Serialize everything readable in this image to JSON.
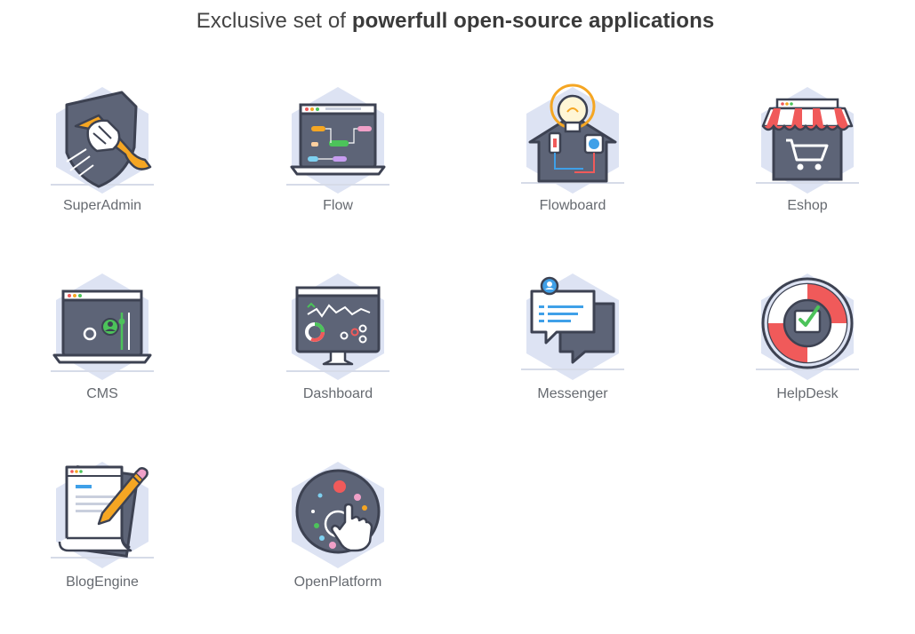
{
  "heading": {
    "prefix": "Exclusive set of",
    "strong": "powerfull open-source applications"
  },
  "apps": [
    {
      "label": "SuperAdmin",
      "icon": "wrench-hand-icon"
    },
    {
      "label": "Flow",
      "icon": "laptop-flow-icon"
    },
    {
      "label": "Flowboard",
      "icon": "lightbulb-socket-icon"
    },
    {
      "label": "Eshop",
      "icon": "shop-cart-icon"
    },
    {
      "label": "CMS",
      "icon": "laptop-settings-icon"
    },
    {
      "label": "Dashboard",
      "icon": "monitor-dashboard-icon"
    },
    {
      "label": "Messenger",
      "icon": "chat-bubbles-icon"
    },
    {
      "label": "HelpDesk",
      "icon": "lifebuoy-icon"
    },
    {
      "label": "BlogEngine",
      "icon": "document-pencil-icon"
    },
    {
      "label": "OpenPlatform",
      "icon": "touch-platform-icon"
    }
  ],
  "colors": {
    "hexagon": "#dde3f3",
    "dark": "#5d6477",
    "outline": "#3d4252",
    "red": "#f05a5a",
    "orange": "#f5a623",
    "green": "#4cc35a",
    "blue": "#3fa0e8",
    "label": "#666a70"
  }
}
